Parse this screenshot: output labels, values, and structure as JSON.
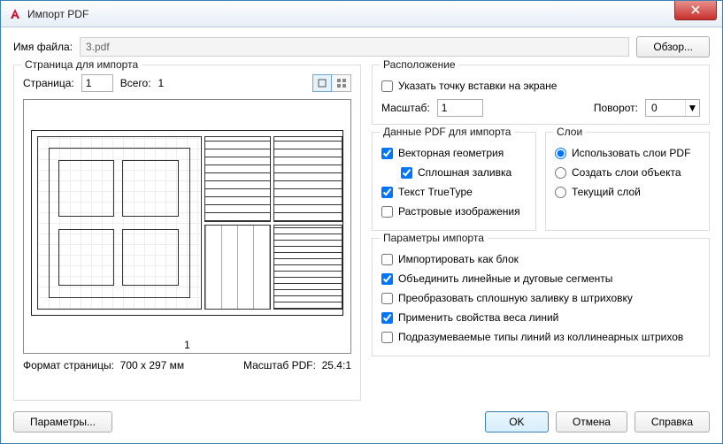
{
  "window": {
    "title": "Импорт PDF"
  },
  "file": {
    "label": "Имя файла:",
    "name": "3.pdf",
    "browse": "Обзор..."
  },
  "pageGroup": {
    "legend": "Страница для импорта",
    "pageLabel": "Страница:",
    "pageValue": "1",
    "totalLabel": "Всего:",
    "totalValue": "1",
    "previewPageNum": "1",
    "sizeLabel": "Формат страницы:",
    "sizeValue": "700 x  297 мм",
    "pdfScaleLabel": "Масштаб PDF:",
    "pdfScaleValue": "25.4:1"
  },
  "location": {
    "legend": "Расположение",
    "specifyOnScreen": {
      "label": "Указать точку вставки на экране",
      "checked": false
    },
    "scaleLabel": "Масштаб:",
    "scaleValue": "1",
    "rotationLabel": "Поворот:",
    "rotationValue": "0"
  },
  "pdfData": {
    "legend": "Данные PDF для импорта",
    "vectorGeometry": {
      "label": "Векторная геометрия",
      "checked": true
    },
    "solidFill": {
      "label": "Сплошная заливка",
      "checked": true
    },
    "trueType": {
      "label": "Текст TrueType",
      "checked": true
    },
    "raster": {
      "label": "Растровые изображения",
      "checked": false
    }
  },
  "layers": {
    "legend": "Слои",
    "options": [
      {
        "label": "Использовать слои PDF",
        "value": "pdf"
      },
      {
        "label": "Создать слои объекта",
        "value": "obj"
      },
      {
        "label": "Текущий слой",
        "value": "cur"
      }
    ],
    "selected": "pdf"
  },
  "importOpts": {
    "legend": "Параметры импорта",
    "asBlock": {
      "label": "Импортировать как блок",
      "checked": false
    },
    "joinSegments": {
      "label": "Объединить линейные и дуговые сегменты",
      "checked": true
    },
    "convertFill": {
      "label": "Преобразовать сплошную заливку в штриховку",
      "checked": false
    },
    "applyLineweight": {
      "label": "Применить свойства веса линий",
      "checked": true
    },
    "inferLinetypes": {
      "label": "Подразумеваемые типы линий из коллинеарных штрихов",
      "checked": false
    }
  },
  "buttons": {
    "options": "Параметры...",
    "ok": "OK",
    "cancel": "Отмена",
    "help": "Справка"
  }
}
